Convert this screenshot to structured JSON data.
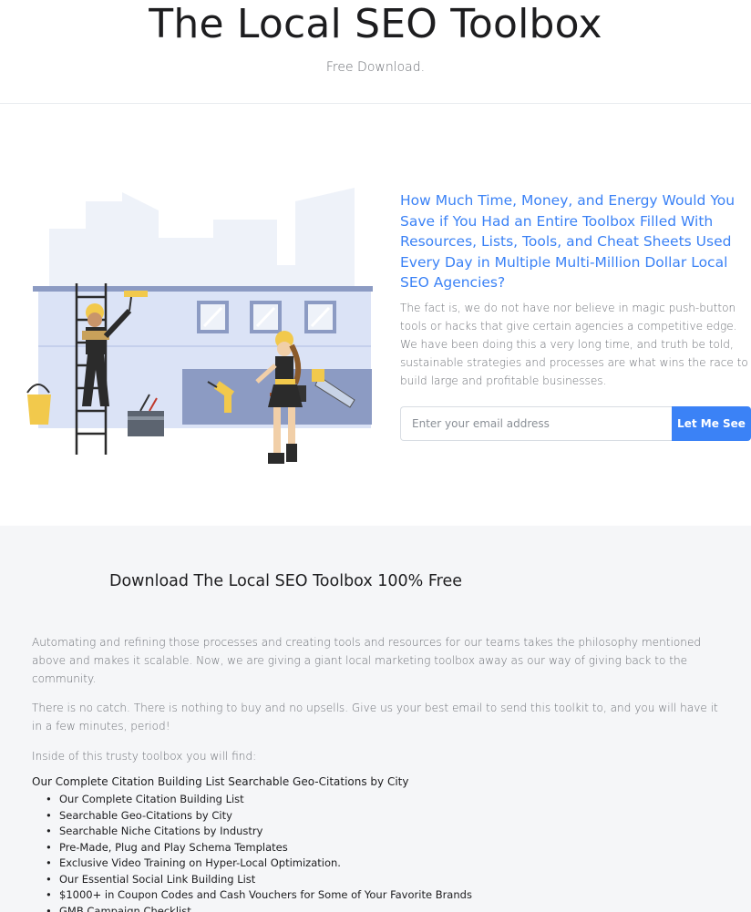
{
  "header": {
    "title": "The Local SEO Toolbox",
    "subtitle": "Free Download."
  },
  "hero": {
    "heading": "How Much Time, Money, and Energy Would You Save if You Had an Entire Toolbox Filled With Resources, Lists, Tools, and Cheat Sheets Used Every Day in Multiple Multi-Million Dollar Local SEO Agencies?",
    "body": "The fact is, we do not have nor believe in magic push-button tools or hacks that give certain agencies a competitive edge. We have been doing this a very long time, and truth be told, sustainable strategies and processes are what wins the race to build large and profitable businesses.",
    "email_placeholder": "Enter your email address",
    "email_value": "",
    "submit_label": "Let Me See",
    "accent_color": "#3b82f6"
  },
  "download": {
    "heading": "Download The Local SEO Toolbox 100% Free",
    "paragraph1": "Automating and refining those processes and creating tools and resources for our teams takes the philosophy mentioned above and makes it scalable. Now, we are giving a giant local marketing toolbox away as our way of giving back to the community.",
    "paragraph2": "There is no catch. There is nothing to buy and no upsells. Give us your best email to send this toolkit to, and you will have it in a few minutes, period!",
    "paragraph3": "Inside of this trusty toolbox you will find:",
    "list_title": "Our Complete Citation Building List Searchable Geo-Citations by City",
    "items": [
      "Our Complete Citation Building List",
      "Searchable Geo-Citations by City",
      "Searchable Niche Citations by Industry",
      "Pre-Made, Plug and Play Schema Templates",
      "Exclusive Video Training on Hyper-Local Optimization.",
      "Our Essential Social Link Building List",
      "$1000+ in Coupon Codes and Cash Vouchers for Some of Your Favorite Brands",
      "GMB Campaign Checklist"
    ]
  },
  "illustration": {
    "icons": [
      "construction-scene-illustration",
      "ladder-icon",
      "paint-roller-icon",
      "paint-bucket-icon",
      "toolbox-icon",
      "drill-icon",
      "hammer-icon",
      "saw-icon"
    ]
  }
}
